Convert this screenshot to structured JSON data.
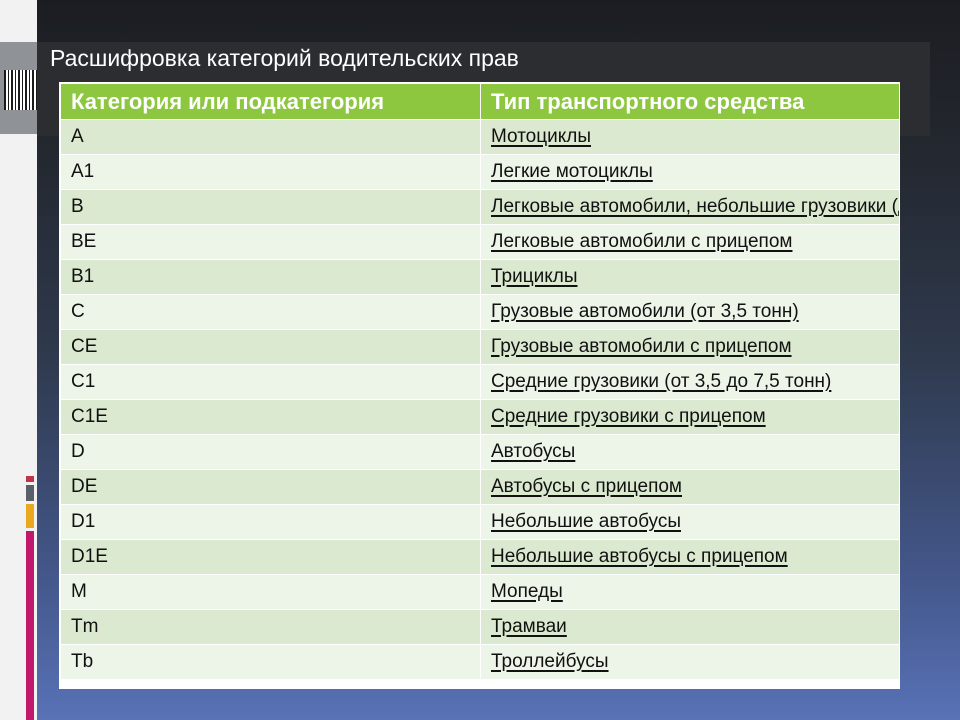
{
  "slide": {
    "title": "Расшифровка категорий водительских прав"
  },
  "table": {
    "headers": [
      "Категория или подкатегория",
      "Тип транспортного средства"
    ],
    "rows": [
      {
        "category": "A",
        "type": "Мотоциклы"
      },
      {
        "category": "A1",
        "type": "Легкие мотоциклы"
      },
      {
        "category": "B",
        "type": "Легковые автомобили, небольшие грузовики (д"
      },
      {
        "category": "BE",
        "type": "Легковые автомобили с прицепом"
      },
      {
        "category": "B1",
        "type": "Трициклы"
      },
      {
        "category": "C",
        "type": "Грузовые автомобили (от 3,5 тонн)"
      },
      {
        "category": "CE",
        "type": "Грузовые автомобили с прицепом"
      },
      {
        "category": "C1",
        "type": "Средние грузовики (от 3,5 до 7,5 тонн)"
      },
      {
        "category": "C1E",
        "type": "Средние грузовики с прицепом"
      },
      {
        "category": "D",
        "type": "Автобусы"
      },
      {
        "category": "DE",
        "type": "Автобусы с прицепом"
      },
      {
        "category": "D1",
        "type": "Небольшие автобусы"
      },
      {
        "category": "D1E",
        "type": "Небольшие автобусы с прицепом"
      },
      {
        "category": "M",
        "type": "Мопеды"
      },
      {
        "category": "Tm",
        "type": "Трамваи"
      },
      {
        "category": "Tb",
        "type": "Троллейбусы"
      }
    ]
  },
  "colors": {
    "header_bg": "#8dc63f",
    "row_odd": "#dbe9d0",
    "row_even": "#edf4e8",
    "accent_red": "#c0334a",
    "accent_gray": "#5a6068",
    "accent_orange": "#e9a81d",
    "accent_magenta": "#c2186b"
  }
}
